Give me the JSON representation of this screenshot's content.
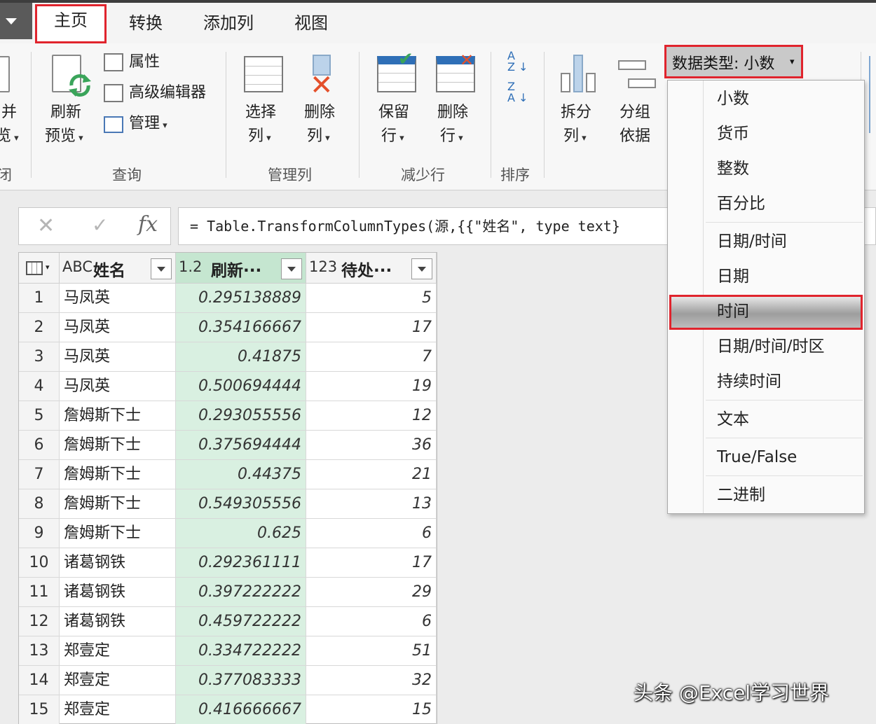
{
  "tabs": [
    {
      "label": "主页",
      "selected": true
    },
    {
      "label": "转换",
      "selected": false
    },
    {
      "label": "添加列",
      "selected": false
    },
    {
      "label": "视图",
      "selected": false
    }
  ],
  "ribbon": {
    "close_partial": {
      "line1": "并",
      "line2": "览",
      "group": "闭"
    },
    "refresh": {
      "line1": "刷新",
      "line2": "预览"
    },
    "properties": "属性",
    "advanced_editor": "高级编辑器",
    "manage": "管理",
    "query_group": "查询",
    "choose_columns": {
      "line1": "选择",
      "line2": "列"
    },
    "remove_columns": {
      "line1": "删除",
      "line2": "列"
    },
    "manage_columns_group": "管理列",
    "keep_rows": {
      "line1": "保留",
      "line2": "行"
    },
    "remove_rows": {
      "line1": "删除",
      "line2": "行"
    },
    "reduce_rows_group": "减少行",
    "sort_group": "排序",
    "split_column": {
      "line1": "拆分",
      "line2": "列"
    },
    "group_by": {
      "line1": "分组",
      "line2": "依据"
    },
    "data_type_button": "数据类型: 小数"
  },
  "formula_bar": {
    "fx": "fx",
    "formula": "= Table.TransformColumnTypes(源,{{\"姓名\", type text}"
  },
  "grid": {
    "columns": [
      {
        "type": "ABC",
        "title": "姓名"
      },
      {
        "type": "1.2",
        "title": "刷新···"
      },
      {
        "type": "123",
        "title": "待处···"
      }
    ],
    "rows": [
      {
        "idx": "1",
        "name": "马凤英",
        "refresh": "0.295138889",
        "pending": "5"
      },
      {
        "idx": "2",
        "name": "马凤英",
        "refresh": "0.354166667",
        "pending": "17"
      },
      {
        "idx": "3",
        "name": "马凤英",
        "refresh": "0.41875",
        "pending": "7"
      },
      {
        "idx": "4",
        "name": "马凤英",
        "refresh": "0.500694444",
        "pending": "19"
      },
      {
        "idx": "5",
        "name": "詹姆斯下士",
        "refresh": "0.293055556",
        "pending": "12"
      },
      {
        "idx": "6",
        "name": "詹姆斯下士",
        "refresh": "0.375694444",
        "pending": "36"
      },
      {
        "idx": "7",
        "name": "詹姆斯下士",
        "refresh": "0.44375",
        "pending": "21"
      },
      {
        "idx": "8",
        "name": "詹姆斯下士",
        "refresh": "0.549305556",
        "pending": "13"
      },
      {
        "idx": "9",
        "name": "詹姆斯下士",
        "refresh": "0.625",
        "pending": "6"
      },
      {
        "idx": "10",
        "name": "诸葛钢铁",
        "refresh": "0.292361111",
        "pending": "17"
      },
      {
        "idx": "11",
        "name": "诸葛钢铁",
        "refresh": "0.397222222",
        "pending": "29"
      },
      {
        "idx": "12",
        "name": "诸葛钢铁",
        "refresh": "0.459722222",
        "pending": "6"
      },
      {
        "idx": "13",
        "name": "郑壹定",
        "refresh": "0.334722222",
        "pending": "51"
      },
      {
        "idx": "14",
        "name": "郑壹定",
        "refresh": "0.377083333",
        "pending": "32"
      },
      {
        "idx": "15",
        "name": "郑壹定",
        "refresh": "0.416666667",
        "pending": "15"
      }
    ]
  },
  "menu": {
    "items": [
      "小数",
      "货币",
      "整数",
      "百分比",
      "日期/时间",
      "日期",
      "时间",
      "日期/时间/时区",
      "持续时间",
      "文本",
      "True/False",
      "二进制"
    ],
    "highlighted": "时间"
  },
  "watermark": "头条 @Excel学习世界",
  "colors": {
    "highlight_red": "#e0242d",
    "selected_column": "#d9f0e1",
    "ribbon_bg": "#f7f7f7"
  }
}
